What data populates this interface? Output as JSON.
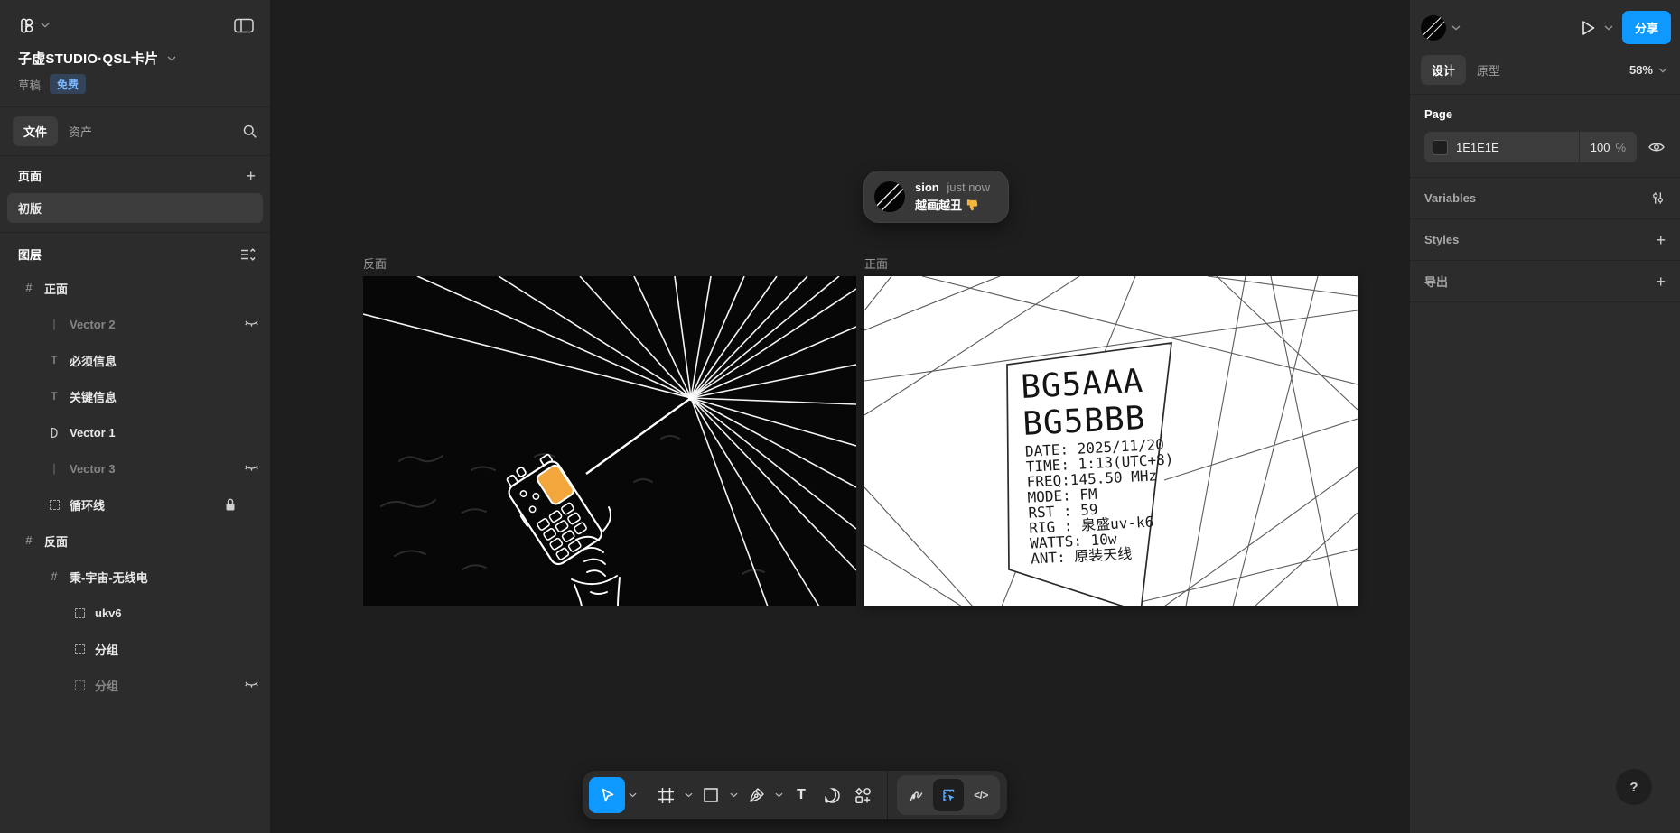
{
  "icons": {
    "frame_glyph": "#",
    "text_glyph": "T",
    "line_glyph": "|",
    "plus_glyph": "+",
    "question_glyph": "?",
    "code_glyph": "</>",
    "percent_glyph": "%"
  },
  "colors": {
    "accent_blue": "#0d99ff",
    "panel_bg": "#2c2c2c",
    "canvas_bg": "#1e1e1e",
    "radio_screen_orange": "#f2a63c"
  },
  "left_sidebar": {
    "doc_title": "子虚STUDIO·QSL卡片",
    "draft_label": "草稿",
    "plan_badge": "免费",
    "tab_file": "文件",
    "tab_assets": "资产",
    "pages_header": "页面",
    "pages": [
      {
        "name": "初版"
      }
    ],
    "layers_header": "图层",
    "layers": [
      {
        "name": "正面"
      },
      {
        "name": "Vector 2"
      },
      {
        "name": "必须信息"
      },
      {
        "name": "关键信息"
      },
      {
        "name": "Vector 1"
      },
      {
        "name": "Vector 3"
      },
      {
        "name": "循环线"
      },
      {
        "name": "反面"
      },
      {
        "name": "秉-宇宙-无线电"
      },
      {
        "name": "ukv6"
      },
      {
        "name": "分组"
      },
      {
        "name": "分组"
      }
    ]
  },
  "canvas": {
    "comment": {
      "author": "sion",
      "timestamp": "just now",
      "message": "越画越丑",
      "emoji": "👎"
    },
    "back_frame_label": "反面",
    "front_frame_label": "正面",
    "qsl_card": {
      "callsign_line1": "BG5AAA",
      "callsign_line2": "BG5BBB",
      "details": [
        "DATE: 2025/11/20",
        "TIME: 1:13(UTC+8)",
        "FREQ:145.50 MHz",
        "MODE: FM",
        "RST : 59",
        "RIG : 泉盛uv-k6",
        "WATTS: 10w",
        "ANT: 原装天线"
      ]
    }
  },
  "right_sidebar": {
    "share_button": "分享",
    "tab_design": "设计",
    "tab_prototype": "原型",
    "zoom_value": "58%",
    "page_header": "Page",
    "page_color_hex": "1E1E1E",
    "page_opacity": "100",
    "variables_label": "Variables",
    "styles_label": "Styles",
    "export_label": "导出"
  }
}
